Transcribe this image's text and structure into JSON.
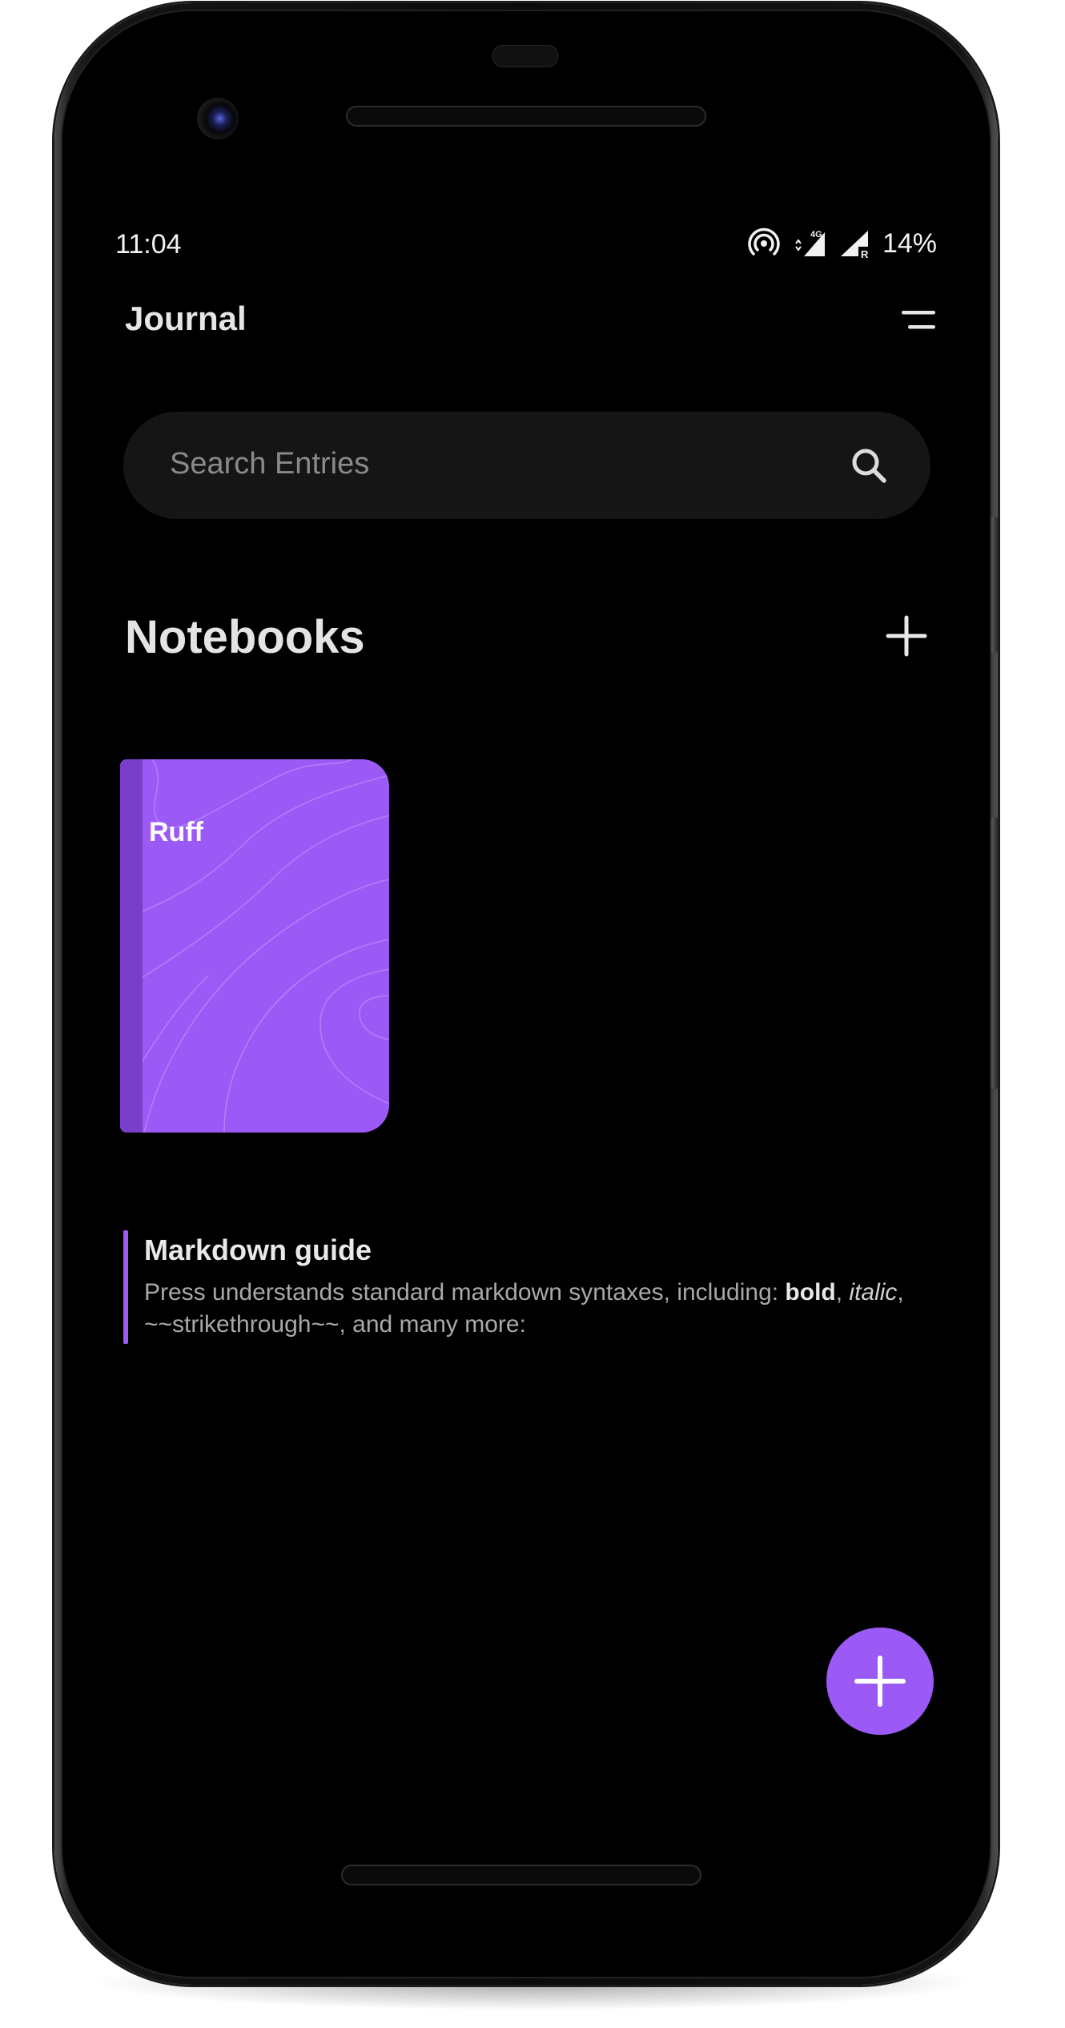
{
  "status_bar": {
    "time": "11:04",
    "network_type": "4G",
    "roaming_indicator": "R",
    "battery": "14%"
  },
  "app": {
    "title": "Journal",
    "menu_icon": "menu-lines-icon"
  },
  "search": {
    "placeholder": "Search Entries",
    "icon": "search-icon"
  },
  "notebooks": {
    "heading": "Notebooks",
    "add_icon": "plus-icon",
    "items": [
      {
        "title": "Ruff",
        "color": "#9b59f6"
      }
    ]
  },
  "entries": [
    {
      "title": "Markdown guide",
      "preview_prefix": "Press understands standard markdown syntaxes, including: ",
      "preview_bold": "bold",
      "preview_sep": ", ",
      "preview_italic": "italic",
      "preview_suffix": ", ~~strikethrough~~, and many more:"
    }
  ],
  "fab": {
    "icon": "plus-icon"
  },
  "colors": {
    "accent": "#9b59f6",
    "background": "#000000",
    "search_bg": "#151515"
  }
}
